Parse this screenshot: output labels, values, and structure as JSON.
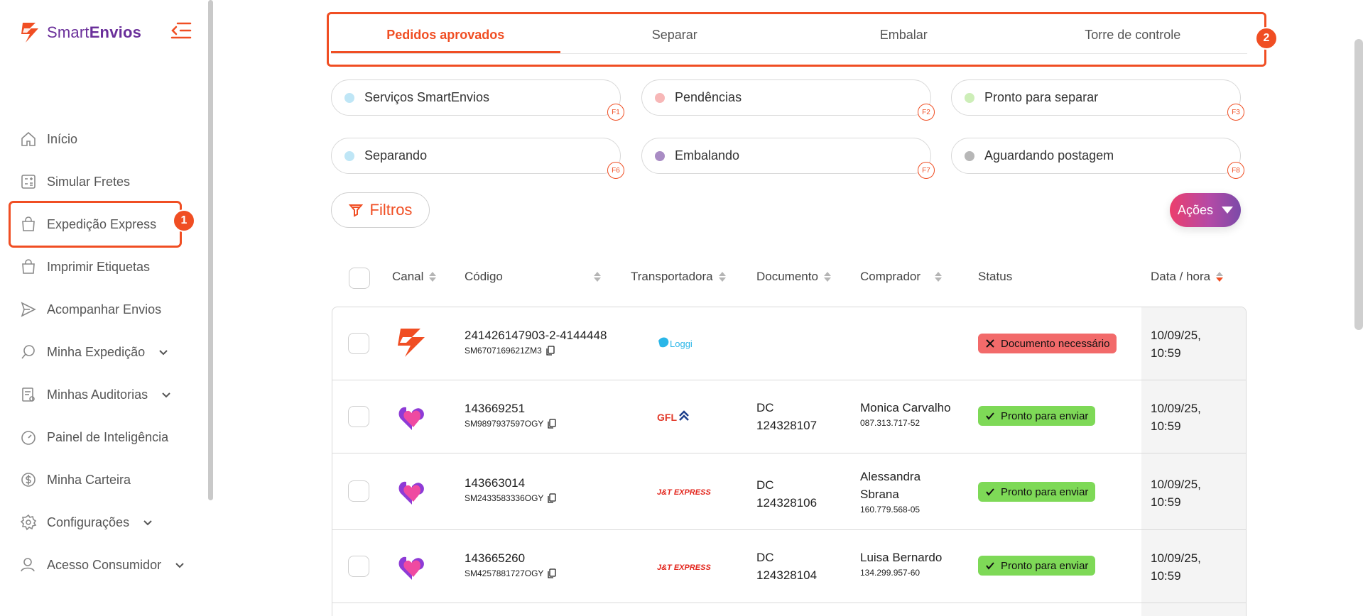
{
  "brand": {
    "name_light": "Smart",
    "name_bold": "Envios"
  },
  "colors": {
    "accent": "#f04e23",
    "purple": "#6a2f9a",
    "status_error": "#f26a6a",
    "status_ok": "#7ed957"
  },
  "sidebar": {
    "items": [
      {
        "label": "Início",
        "icon": "home-icon",
        "has_chevron": false
      },
      {
        "label": "Simular Fretes",
        "icon": "calculator-icon",
        "has_chevron": false
      },
      {
        "label": "Expedição Express",
        "icon": "bag-icon",
        "has_chevron": false
      },
      {
        "label": "Imprimir Etiquetas",
        "icon": "bag-icon",
        "has_chevron": false
      },
      {
        "label": "Acompanhar Envios",
        "icon": "send-icon",
        "has_chevron": false
      },
      {
        "label": "Minha Expedição",
        "icon": "search-chat-icon",
        "has_chevron": true
      },
      {
        "label": "Minhas Auditorias",
        "icon": "clipboard-icon",
        "has_chevron": true
      },
      {
        "label": "Painel de Inteligência",
        "icon": "gauge-icon",
        "has_chevron": false
      },
      {
        "label": "Minha Carteira",
        "icon": "dollar-icon",
        "has_chevron": false
      },
      {
        "label": "Configurações",
        "icon": "gear-icon",
        "has_chevron": true
      },
      {
        "label": "Acesso Consumidor",
        "icon": "user-icon",
        "has_chevron": true
      }
    ]
  },
  "annotations": {
    "one": "1",
    "two": "2"
  },
  "tabs": [
    {
      "label": "Pedidos aprovados",
      "active": true
    },
    {
      "label": "Separar",
      "active": false
    },
    {
      "label": "Embalar",
      "active": false
    },
    {
      "label": "Torre de controle",
      "active": false
    }
  ],
  "status_filters": [
    {
      "label": "Serviços SmartEnvios",
      "key": "F1",
      "dot": "#bfe6f6"
    },
    {
      "label": "Pendências",
      "key": "F2",
      "dot": "#f7b7b7"
    },
    {
      "label": "Pronto para separar",
      "key": "F3",
      "dot": "#cdeeb8"
    },
    {
      "label": "Separando",
      "key": "F6",
      "dot": "#bfe6f6"
    },
    {
      "label": "Embalando",
      "key": "F7",
      "dot": "#a98cc4"
    },
    {
      "label": "Aguardando postagem",
      "key": "F8",
      "dot": "#b7b7b7"
    }
  ],
  "toolbar": {
    "filters_label": "Filtros",
    "actions_label": "Ações"
  },
  "table": {
    "headers": {
      "canal": "Canal",
      "codigo": "Código",
      "transportadora": "Transportadora",
      "documento": "Documento",
      "comprador": "Comprador",
      "status": "Status",
      "data": "Data / hora"
    },
    "rows": [
      {
        "canal": "smartenvios-logo",
        "code": "241426147903-2-4144448",
        "sub_code": "SM6707169621ZM3",
        "carrier": "Loggi",
        "doc_line1": "",
        "doc_line2": "",
        "buyer_line1": "",
        "buyer_line2": "",
        "cpf": "",
        "status": "Documento necessário",
        "status_type": "err",
        "date_line1": "10/09/25,",
        "date_line2": "10:59"
      },
      {
        "canal": "heart-logo",
        "code": "143669251",
        "sub_code": "SM9897937597OGY",
        "carrier": "GFL",
        "doc_line1": "DC",
        "doc_line2": "124328107",
        "buyer_line1": "Monica Carvalho",
        "buyer_line2": "",
        "cpf": "087.313.717-52",
        "status": "Pronto para enviar",
        "status_type": "ok",
        "date_line1": "10/09/25,",
        "date_line2": "10:59"
      },
      {
        "canal": "heart-logo",
        "code": "143663014",
        "sub_code": "SM2433583336OGY",
        "carrier": "J&T EXPRESS",
        "doc_line1": "DC",
        "doc_line2": "124328106",
        "buyer_line1": "Alessandra",
        "buyer_line2": "Sbrana",
        "cpf": "160.779.568-05",
        "status": "Pronto para enviar",
        "status_type": "ok",
        "date_line1": "10/09/25,",
        "date_line2": "10:59"
      },
      {
        "canal": "heart-logo",
        "code": "143665260",
        "sub_code": "SM4257881727OGY",
        "carrier": "J&T EXPRESS",
        "doc_line1": "DC",
        "doc_line2": "124328104",
        "buyer_line1": "Luisa Bernardo",
        "buyer_line2": "",
        "cpf": "134.299.957-60",
        "status": "Pronto para enviar",
        "status_type": "ok",
        "date_line1": "10/09/25,",
        "date_line2": "10:59"
      }
    ]
  }
}
